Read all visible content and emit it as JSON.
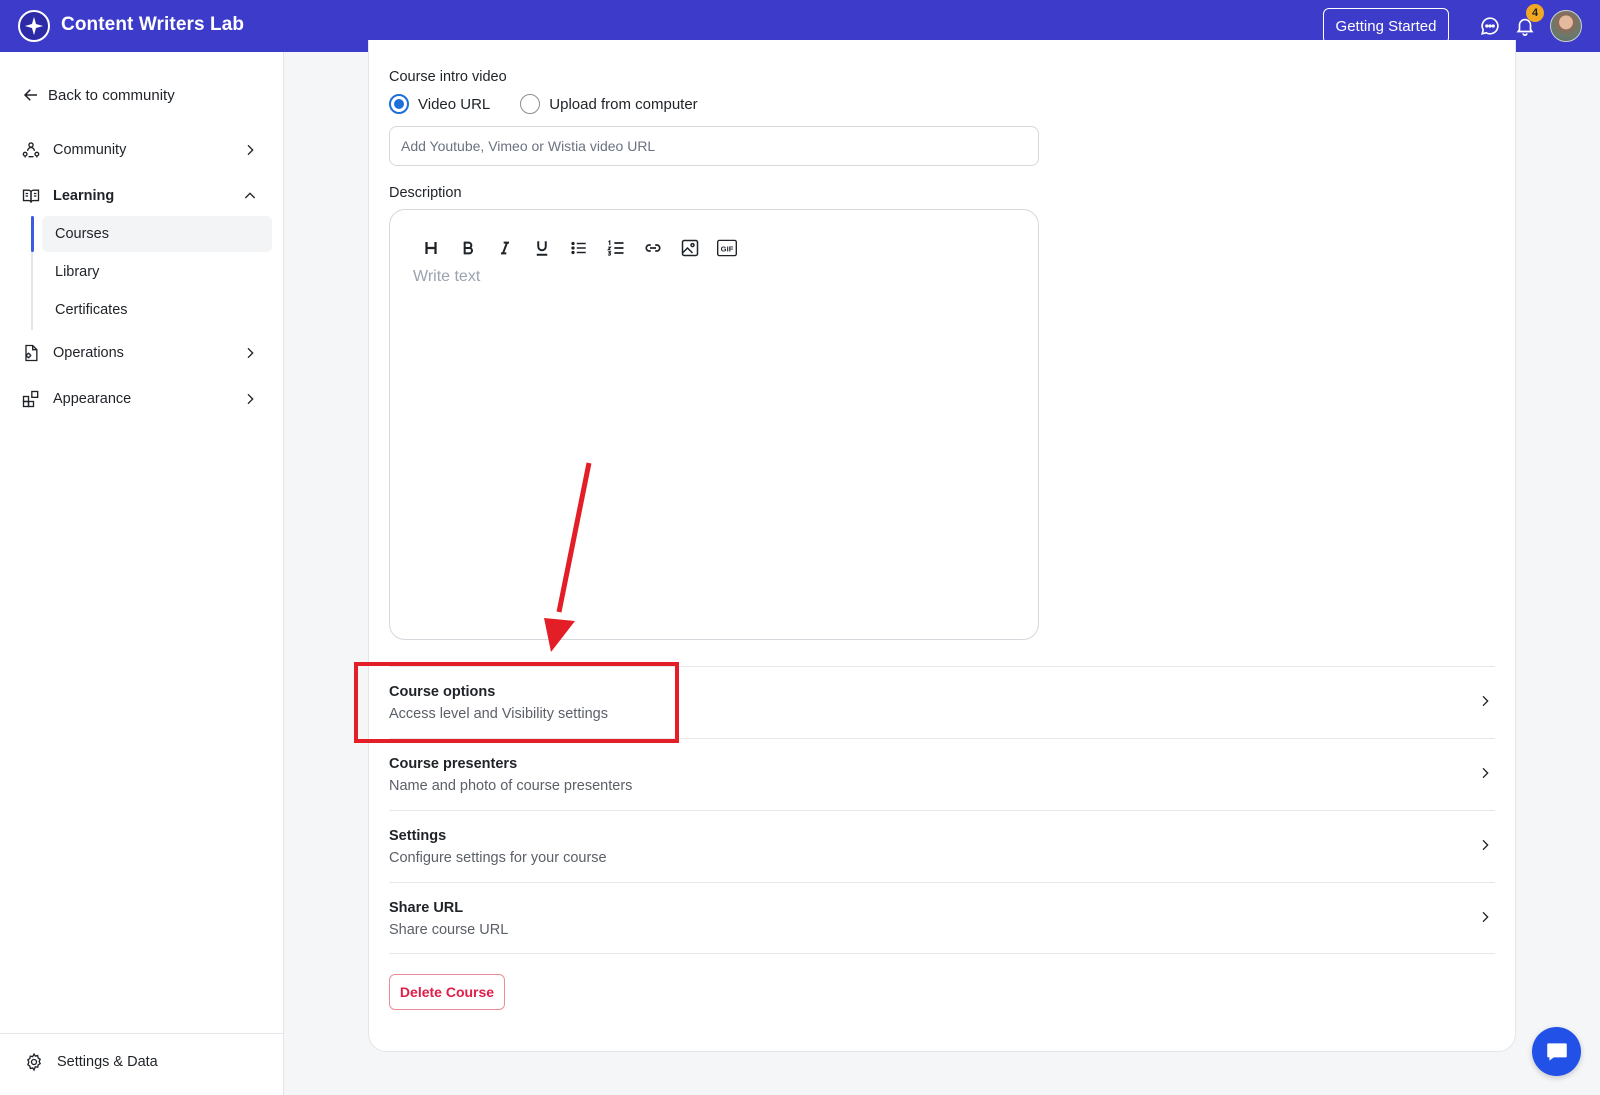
{
  "header": {
    "brand_name": "Content Writers Lab",
    "getting_started_label": "Getting Started",
    "notification_count": "4",
    "accent_color": "#3d3bc9"
  },
  "sidebar": {
    "back_label": "Back to community",
    "items": [
      {
        "label": "Community",
        "icon": "community-icon"
      },
      {
        "label": "Learning",
        "icon": "book-icon",
        "expanded": true
      },
      {
        "label": "Operations",
        "icon": "operations-icon"
      },
      {
        "label": "Appearance",
        "icon": "appearance-icon"
      }
    ],
    "learning_sub": [
      {
        "label": "Courses",
        "active": true
      },
      {
        "label": "Library"
      },
      {
        "label": "Certificates"
      }
    ],
    "footer_label": "Settings & Data"
  },
  "main": {
    "intro_video_label": "Course intro video",
    "radio_video_url": "Video URL",
    "radio_upload": "Upload from computer",
    "url_placeholder": "Add Youtube, Vimeo or Wistia video URL",
    "description_label": "Description",
    "editor_placeholder": "Write text",
    "toolbar_icons": [
      "heading-icon",
      "bold-icon",
      "italic-icon",
      "underline-icon",
      "bullet-list-icon",
      "numbered-list-icon",
      "link-icon",
      "image-icon",
      "gif-icon"
    ],
    "options": [
      {
        "title": "Course options",
        "subtitle": "Access level and Visibility settings"
      },
      {
        "title": "Course presenters",
        "subtitle": "Name and photo of course presenters"
      },
      {
        "title": "Settings",
        "subtitle": "Configure settings for your course"
      },
      {
        "title": "Share URL",
        "subtitle": "Share course URL"
      }
    ],
    "delete_label": "Delete Course",
    "annotation_color": "#e41e26"
  }
}
